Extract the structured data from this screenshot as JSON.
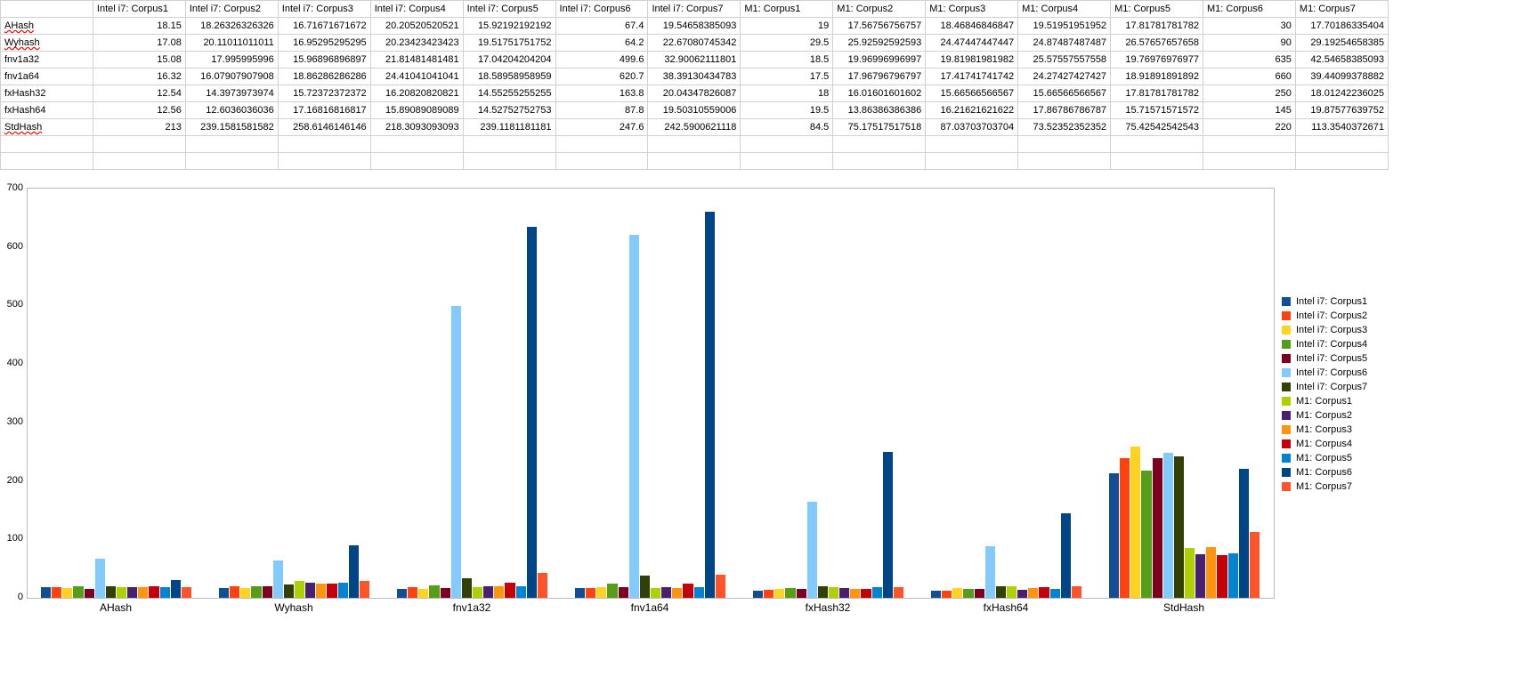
{
  "columns": [
    "Intel i7: Corpus1",
    "Intel i7: Corpus2",
    "Intel i7: Corpus3",
    "Intel i7: Corpus4",
    "Intel i7: Corpus5",
    "Intel i7: Corpus6",
    "Intel i7: Corpus7",
    "M1: Corpus1",
    "M1: Corpus2",
    "M1: Corpus3",
    "M1: Corpus4",
    "M1: Corpus5",
    "M1: Corpus6",
    "M1: Corpus7"
  ],
  "rows": [
    {
      "label": "AHash",
      "spell": true,
      "cells": [
        "18.15",
        "18.26326326326",
        "16.71671671672",
        "20.20520520521",
        "15.92192192192",
        "67.4",
        "19.54658385093",
        "19",
        "17.56756756757",
        "18.46846846847",
        "19.51951951952",
        "17.81781781782",
        "30",
        "17.70186335404"
      ]
    },
    {
      "label": "Wyhash",
      "spell": true,
      "cells": [
        "17.08",
        "20.11011011011",
        "16.95295295295",
        "20.23423423423",
        "19.51751751752",
        "64.2",
        "22.67080745342",
        "29.5",
        "25.92592592593",
        "24.47447447447",
        "24.87487487487",
        "26.57657657658",
        "90",
        "29.19254658385"
      ]
    },
    {
      "label": "fnv1a32",
      "spell": false,
      "cells": [
        "15.08",
        "17.995995996",
        "15.96896896897",
        "21.81481481481",
        "17.04204204204",
        "499.6",
        "32.90062111801",
        "18.5",
        "19.96996996997",
        "19.81981981982",
        "25.57557557558",
        "19.76976976977",
        "635",
        "42.54658385093"
      ]
    },
    {
      "label": "fnv1a64",
      "spell": false,
      "cells": [
        "16.32",
        "16.07907907908",
        "18.86286286286",
        "24.41041041041",
        "18.58958958959",
        "620.7",
        "38.39130434783",
        "17.5",
        "17.96796796797",
        "17.41741741742",
        "24.27427427427",
        "18.91891891892",
        "660",
        "39.44099378882"
      ]
    },
    {
      "label": "fxHash32",
      "spell": false,
      "cells": [
        "12.54",
        "14.3973973974",
        "15.72372372372",
        "16.20820820821",
        "14.55255255255",
        "163.8",
        "20.04347826087",
        "18",
        "16.01601601602",
        "15.66566566567",
        "15.66566566567",
        "17.81781781782",
        "250",
        "18.01242236025"
      ]
    },
    {
      "label": "fxHash64",
      "spell": false,
      "cells": [
        "12.56",
        "12.6036036036",
        "17.16816816817",
        "15.89089089089",
        "14.52752752753",
        "87.8",
        "19.50310559006",
        "19.5",
        "13.86386386386",
        "16.21621621622",
        "17.86786786787",
        "15.71571571572",
        "145",
        "19.87577639752"
      ]
    },
    {
      "label": "StdHash",
      "spell": true,
      "cells": [
        "213",
        "239.1581581582",
        "258.6146146146",
        "218.3093093093",
        "239.1181181181",
        "247.6",
        "242.5900621118",
        "84.5",
        "75.17517517518",
        "87.03703703704",
        "73.52352352352",
        "75.42542542543",
        "220",
        "113.3540372671"
      ]
    }
  ],
  "chart_data": {
    "type": "bar",
    "categories": [
      "AHash",
      "Wyhash",
      "fnv1a32",
      "fnv1a64",
      "fxHash32",
      "fxHash64",
      "StdHash"
    ],
    "series": [
      {
        "name": "Intel i7: Corpus1",
        "color": "#124e94",
        "values": [
          18.15,
          17.08,
          15.08,
          16.32,
          12.54,
          12.56,
          213
        ]
      },
      {
        "name": "Intel i7: Corpus2",
        "color": "#ff420e",
        "values": [
          18.26,
          20.11,
          18.0,
          16.08,
          14.4,
          12.6,
          239.16
        ]
      },
      {
        "name": "Intel i7: Corpus3",
        "color": "#ffd320",
        "values": [
          16.72,
          16.95,
          15.97,
          18.86,
          15.72,
          17.17,
          258.61
        ]
      },
      {
        "name": "Intel i7: Corpus4",
        "color": "#579d1c",
        "values": [
          20.21,
          20.23,
          21.81,
          24.41,
          16.21,
          15.89,
          218.31
        ]
      },
      {
        "name": "Intel i7: Corpus5",
        "color": "#7e0021",
        "values": [
          15.92,
          19.52,
          17.04,
          18.59,
          14.55,
          14.53,
          239.12
        ]
      },
      {
        "name": "Intel i7: Corpus6",
        "color": "#83caff",
        "values": [
          67.4,
          64.2,
          499.6,
          620.7,
          163.8,
          87.8,
          247.6
        ]
      },
      {
        "name": "Intel i7: Corpus7",
        "color": "#314004",
        "values": [
          19.55,
          22.67,
          32.9,
          38.39,
          20.04,
          19.5,
          242.59
        ]
      },
      {
        "name": "M1: Corpus1",
        "color": "#aecf00",
        "values": [
          19,
          29.5,
          18.5,
          17.5,
          18,
          19.5,
          84.5
        ]
      },
      {
        "name": "M1: Corpus2",
        "color": "#4b1f6f",
        "values": [
          17.57,
          25.93,
          19.97,
          17.97,
          16.02,
          13.86,
          75.18
        ]
      },
      {
        "name": "M1: Corpus3",
        "color": "#ff950e",
        "values": [
          18.47,
          24.47,
          19.82,
          17.42,
          15.67,
          16.22,
          87.04
        ]
      },
      {
        "name": "M1: Corpus4",
        "color": "#c5000b",
        "values": [
          19.52,
          24.87,
          25.58,
          24.27,
          15.67,
          17.87,
          73.52
        ]
      },
      {
        "name": "M1: Corpus5",
        "color": "#0084d1",
        "values": [
          17.82,
          26.58,
          19.77,
          18.92,
          17.82,
          15.72,
          75.43
        ]
      },
      {
        "name": "M1: Corpus6",
        "color": "#004586",
        "values": [
          30,
          90,
          635,
          660,
          250,
          145,
          220
        ]
      },
      {
        "name": "M1: Corpus7",
        "color": "#ff5429",
        "values": [
          17.7,
          29.19,
          42.55,
          39.44,
          18.01,
          19.88,
          113.35
        ]
      }
    ],
    "ylim": [
      0,
      700
    ],
    "yticks": [
      0,
      100,
      200,
      300,
      400,
      500,
      600,
      700
    ],
    "xlabel": "",
    "ylabel": "",
    "title": ""
  }
}
